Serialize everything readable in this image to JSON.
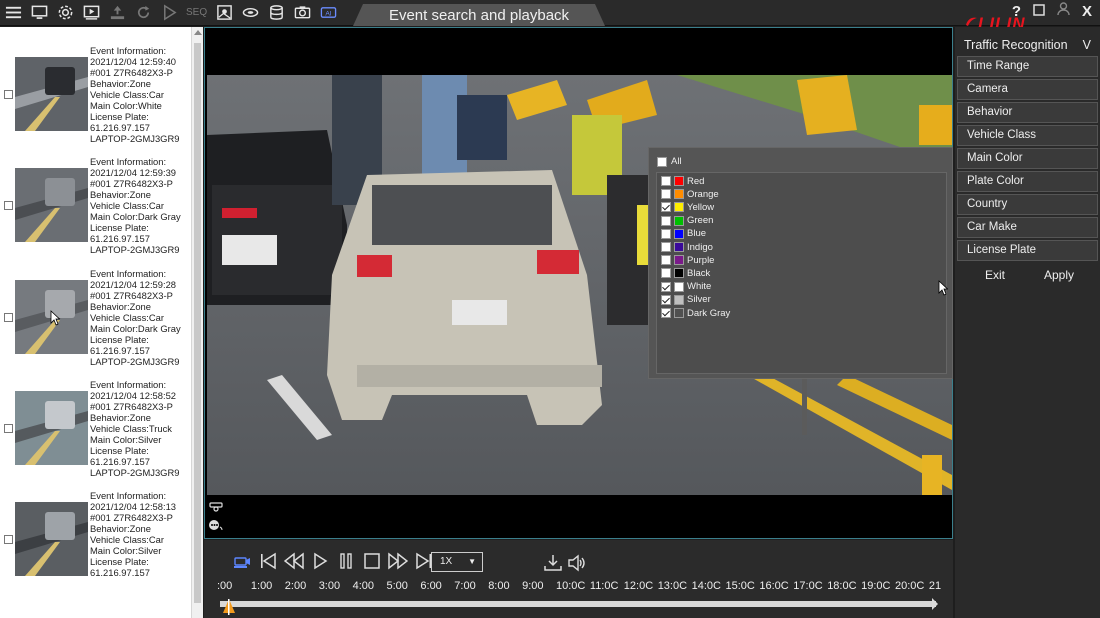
{
  "window": {
    "title": "Event search and playback",
    "seq_label": "SEQ",
    "brand": "LILIN",
    "help_label": "?",
    "close_label": "X"
  },
  "events": [
    {
      "lines": [
        "Event Information:",
        "2021/12/04 12:59:40",
        "#001 Z7R6482X3-P",
        "Behavior:Zone",
        "Vehicle Class:Car",
        "Main Color:White",
        "License Plate:",
        "61.216.97.157",
        "LAPTOP-2GMJ3GR9"
      ]
    },
    {
      "lines": [
        "Event Information:",
        "2021/12/04 12:59:39",
        "#001 Z7R6482X3-P",
        "Behavior:Zone",
        "Vehicle Class:Car",
        "Main Color:Dark Gray",
        "License Plate:",
        "61.216.97.157",
        "LAPTOP-2GMJ3GR9"
      ]
    },
    {
      "lines": [
        "Event Information:",
        "2021/12/04 12:59:28",
        "#001 Z7R6482X3-P",
        "Behavior:Zone",
        "Vehicle Class:Car",
        "Main Color:Dark Gray",
        "License Plate:",
        "61.216.97.157",
        "LAPTOP-2GMJ3GR9"
      ]
    },
    {
      "lines": [
        "Event Information:",
        "2021/12/04 12:58:52",
        "#001 Z7R6482X3-P",
        "Behavior:Zone",
        "Vehicle Class:Truck",
        "Main Color:Silver",
        "License Plate:",
        "61.216.97.157",
        "LAPTOP-2GMJ3GR9"
      ]
    },
    {
      "lines": [
        "Event Information:",
        "2021/12/04 12:58:13",
        "#001 Z7R6482X3-P",
        "Behavior:Zone",
        "Vehicle Class:Car",
        "Main Color:Silver",
        "License Plate:",
        "61.216.97.157"
      ]
    }
  ],
  "color_filter": {
    "all_label": "All",
    "all_checked": false,
    "options": [
      {
        "label": "Red",
        "color": "#ff0000",
        "checked": false
      },
      {
        "label": "Orange",
        "color": "#ff8c00",
        "checked": false
      },
      {
        "label": "Yellow",
        "color": "#ffee00",
        "checked": true
      },
      {
        "label": "Green",
        "color": "#00c000",
        "checked": false
      },
      {
        "label": "Blue",
        "color": "#0000ff",
        "checked": false
      },
      {
        "label": "Indigo",
        "color": "#3a0a9a",
        "checked": false
      },
      {
        "label": "Purple",
        "color": "#7a1a8a",
        "checked": false
      },
      {
        "label": "Black",
        "color": "#000000",
        "checked": false
      },
      {
        "label": "White",
        "color": "#ffffff",
        "checked": true
      },
      {
        "label": "Silver",
        "color": "#c0c0c0",
        "checked": true
      },
      {
        "label": "Dark Gray",
        "color": "#505050",
        "checked": true
      }
    ]
  },
  "right_panel": {
    "title": "Traffic Recognition",
    "toggle_label": "V",
    "filters": [
      "Time Range",
      "Camera",
      "Behavior",
      "Vehicle Class",
      "Main Color",
      "Plate Color",
      "Country",
      "Car Make",
      "License Plate"
    ],
    "exit_label": "Exit",
    "apply_label": "Apply"
  },
  "playback": {
    "speed": "1X",
    "timeline_labels": [
      ":00",
      "1:00",
      "2:00",
      "3:00",
      "4:00",
      "5:00",
      "6:00",
      "7:00",
      "8:00",
      "9:00",
      "10:0C",
      "11:0C",
      "12:0C",
      "13:0C",
      "14:0C",
      "15:0C",
      "16:0C",
      "17:0C",
      "18:0C",
      "19:0C",
      "20:0C",
      "21"
    ]
  },
  "colors": {
    "accent_red": "#e8141e",
    "frame_border": "#3b7f8c",
    "marker_orange": "#f29a1e"
  }
}
